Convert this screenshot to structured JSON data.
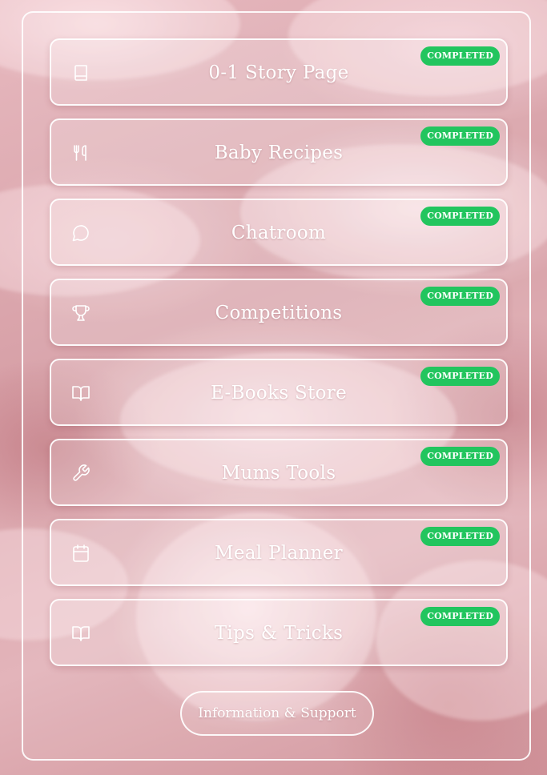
{
  "menu": {
    "items": [
      {
        "label": "0-1 Story Page",
        "icon": "book-icon",
        "badge": "COMPLETED"
      },
      {
        "label": "Baby Recipes",
        "icon": "utensils-icon",
        "badge": "COMPLETED"
      },
      {
        "label": "Chatroom",
        "icon": "chat-bubble-icon",
        "badge": "COMPLETED"
      },
      {
        "label": "Competitions",
        "icon": "trophy-icon",
        "badge": "COMPLETED"
      },
      {
        "label": "E-Books Store",
        "icon": "open-book-icon",
        "badge": "COMPLETED"
      },
      {
        "label": "Mums Tools",
        "icon": "wrench-icon",
        "badge": "COMPLETED"
      },
      {
        "label": "Meal Planner",
        "icon": "calendar-icon",
        "badge": "COMPLETED"
      },
      {
        "label": "Tips & Tricks",
        "icon": "open-book-icon",
        "badge": "COMPLETED"
      }
    ]
  },
  "support": {
    "label": "Information & Support"
  },
  "colors": {
    "badge": "#22c55e",
    "text": "#ffffff",
    "border": "#ffffff"
  }
}
